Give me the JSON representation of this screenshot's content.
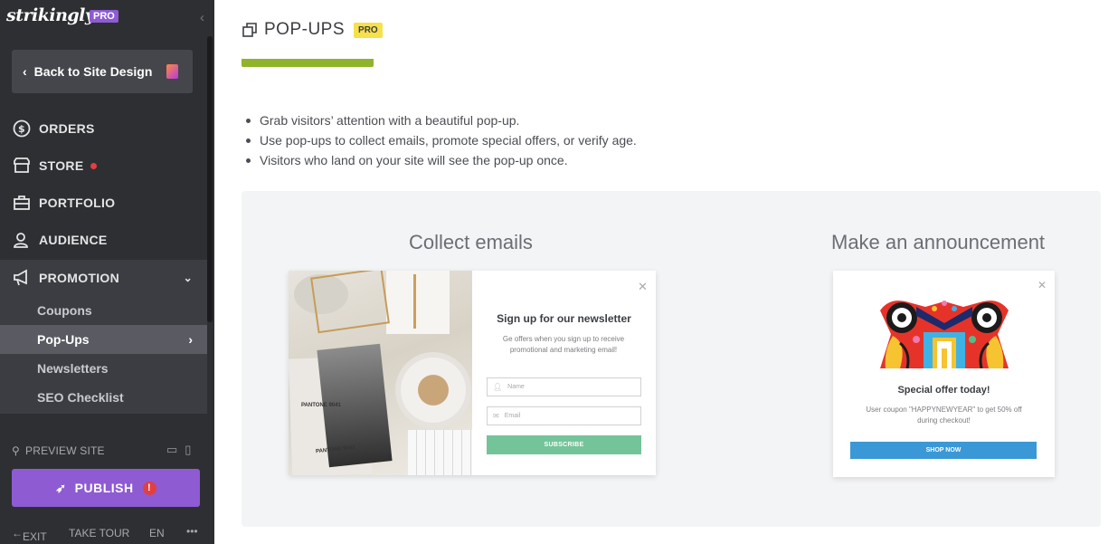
{
  "sidebar": {
    "logo": "strikingly",
    "logo_badge": "PRO",
    "back_button": "Back to Site Design",
    "nav": [
      {
        "label": "ORDERS",
        "icon": "dollar-circle-icon"
      },
      {
        "label": "STORE",
        "icon": "store-icon",
        "has_notification": true
      },
      {
        "label": "PORTFOLIO",
        "icon": "briefcase-icon"
      },
      {
        "label": "AUDIENCE",
        "icon": "people-icon"
      },
      {
        "label": "PROMOTION",
        "icon": "megaphone-icon",
        "expanded": true
      }
    ],
    "promotion_items": [
      {
        "label": "Coupons"
      },
      {
        "label": "Pop-Ups",
        "active": true
      },
      {
        "label": "Newsletters"
      },
      {
        "label": "SEO Checklist"
      }
    ],
    "preview_label": "PREVIEW SITE",
    "publish_label": "PUBLISH",
    "publish_warning": "!",
    "footer": {
      "exit": "EXIT",
      "tour": "TAKE TOUR",
      "lang": "EN",
      "more": "•••"
    }
  },
  "main": {
    "title": "POP-UPS",
    "title_badge": "PRO",
    "bullets": [
      "Grab visitors’ attention with a beautiful pop-up.",
      "Use pop-ups to collect emails, promote special offers, or verify age.",
      "Visitors who land on your site will see the pop-up once."
    ],
    "templates": {
      "collect": {
        "heading": "Collect emails",
        "popup_title": "Sign up for our newsletter",
        "popup_desc": "Ge offers when you sign up to receive promotional and marketing email!",
        "name_placeholder": "Name",
        "email_placeholder": "Email",
        "button": "SUBSCRIBE",
        "pantone_1": "PANTONE 9041",
        "pantone_2": "PANTONE 9041"
      },
      "announcement": {
        "heading": "Make an announcement",
        "popup_title": "Special offer today!",
        "popup_desc": "User coupon \"HAPPYNEWYEAR\" to get 50% off during checkout!",
        "button": "SHOP NOW"
      }
    }
  },
  "colors": {
    "sidebar_bg": "#2e2f33",
    "accent_purple": "#8e5bd3",
    "green_bar": "#8fb42c",
    "pro_yellow": "#f6e14b",
    "subscribe_green": "#74c49a",
    "shop_blue": "#3a98d6"
  }
}
